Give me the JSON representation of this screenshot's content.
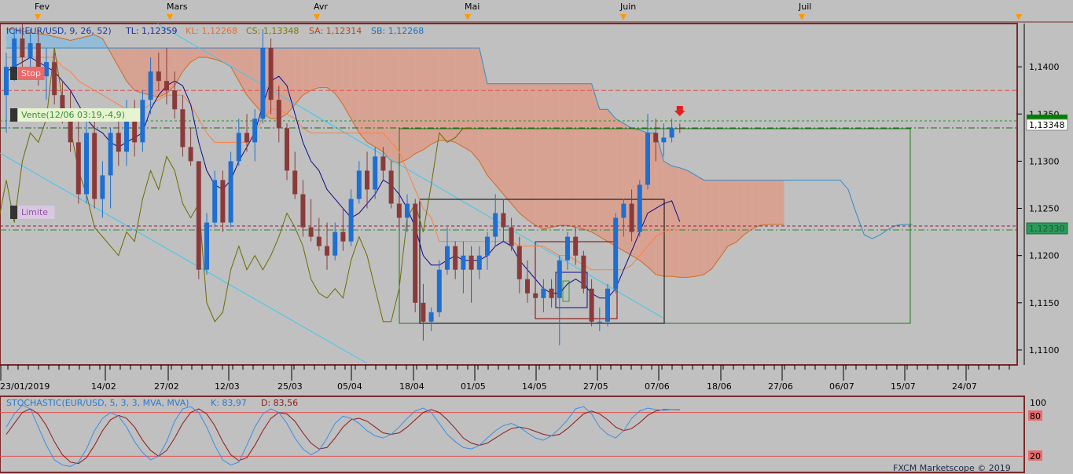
{
  "top_months": [
    "Fev",
    "Mars",
    "Avr",
    "Mai",
    "Juin",
    "Juil"
  ],
  "legend": {
    "indicator": "ICH(EUR/USD, 9, 26, 52)",
    "tl": "TL: 1,12359",
    "kl": "KL: 1,12268",
    "cs": "CS: 1,13348",
    "sa": "SA: 1,12314",
    "sb": "SB: 1,12268"
  },
  "order_labels": {
    "stop": "Stop",
    "vente": "Vente(12/06 03:19,-4,9)",
    "limite": "Limite"
  },
  "price_axis": {
    "ticks": [
      "1,1400",
      "1,1350",
      "1,1300",
      "1,1250",
      "1,1200",
      "1,1150",
      "1,1100"
    ],
    "current_price": "1,13348",
    "current_price_label_color": "#008000",
    "limit_price": "1,12330"
  },
  "date_axis": [
    "23/01/2019",
    "14/02",
    "27/02",
    "12/03",
    "25/03",
    "05/04",
    "18/04",
    "01/05",
    "14/05",
    "27/05",
    "07/06",
    "18/06",
    "27/06",
    "06/07",
    "15/07",
    "24/07"
  ],
  "stoch": {
    "label": "STOCHASTIC(EUR/USD, 5, 3, 3, MVA, MVA)",
    "k": "K: 83,97",
    "d": "D: 83,56",
    "levels": [
      "100",
      "80",
      "20"
    ]
  },
  "brand": "FXCM Marketscope © 2019",
  "colors": {
    "bull": "#1e6fd0",
    "bear": "#8b3a3a",
    "tenkan": "#0a0a8c",
    "kijun": "#ff7f3f",
    "chikou": "#6b6b00",
    "senkou_a": "#d2691e",
    "senkou_b": "#2d8cc8",
    "cloud_bear": "#d9a090",
    "cloud_bull": "#8fbcd8",
    "stoch_k": "#3a8ee6",
    "stoch_d": "#8b1a1a"
  },
  "chart_data": {
    "type": "candlestick",
    "instrument": "EUR/USD",
    "ylim": [
      1.1085,
      1.1445
    ],
    "x_labels": [
      "23/01/2019",
      "14/02",
      "27/02",
      "12/03",
      "25/03",
      "05/04",
      "18/04",
      "01/05",
      "14/05",
      "27/05",
      "07/06",
      "18/06",
      "27/06",
      "06/07",
      "15/07",
      "24/07"
    ],
    "candles": [
      {
        "o": 1.137,
        "h": 1.1415,
        "l": 1.133,
        "c": 1.14
      },
      {
        "o": 1.14,
        "h": 1.144,
        "l": 1.1385,
        "c": 1.143
      },
      {
        "o": 1.143,
        "h": 1.1445,
        "l": 1.14,
        "c": 1.141
      },
      {
        "o": 1.141,
        "h": 1.144,
        "l": 1.1395,
        "c": 1.1425
      },
      {
        "o": 1.1425,
        "h": 1.144,
        "l": 1.138,
        "c": 1.139
      },
      {
        "o": 1.139,
        "h": 1.142,
        "l": 1.1365,
        "c": 1.1405
      },
      {
        "o": 1.1405,
        "h": 1.1415,
        "l": 1.136,
        "c": 1.137
      },
      {
        "o": 1.137,
        "h": 1.1385,
        "l": 1.134,
        "c": 1.135
      },
      {
        "o": 1.135,
        "h": 1.1375,
        "l": 1.131,
        "c": 1.132
      },
      {
        "o": 1.132,
        "h": 1.1345,
        "l": 1.1255,
        "c": 1.1265
      },
      {
        "o": 1.1265,
        "h": 1.1345,
        "l": 1.1255,
        "c": 1.133
      },
      {
        "o": 1.133,
        "h": 1.1345,
        "l": 1.125,
        "c": 1.126
      },
      {
        "o": 1.126,
        "h": 1.13,
        "l": 1.124,
        "c": 1.1285
      },
      {
        "o": 1.1285,
        "h": 1.1335,
        "l": 1.125,
        "c": 1.133
      },
      {
        "o": 1.133,
        "h": 1.1345,
        "l": 1.1295,
        "c": 1.131
      },
      {
        "o": 1.131,
        "h": 1.1365,
        "l": 1.1295,
        "c": 1.1345
      },
      {
        "o": 1.1345,
        "h": 1.1365,
        "l": 1.1305,
        "c": 1.132
      },
      {
        "o": 1.132,
        "h": 1.1375,
        "l": 1.131,
        "c": 1.1365
      },
      {
        "o": 1.1365,
        "h": 1.141,
        "l": 1.135,
        "c": 1.1395
      },
      {
        "o": 1.1395,
        "h": 1.1415,
        "l": 1.1375,
        "c": 1.1385
      },
      {
        "o": 1.1385,
        "h": 1.142,
        "l": 1.136,
        "c": 1.1375
      },
      {
        "o": 1.1375,
        "h": 1.1395,
        "l": 1.1345,
        "c": 1.1355
      },
      {
        "o": 1.1355,
        "h": 1.137,
        "l": 1.1305,
        "c": 1.1315
      },
      {
        "o": 1.1315,
        "h": 1.1335,
        "l": 1.1295,
        "c": 1.13
      },
      {
        "o": 1.13,
        "h": 1.13,
        "l": 1.1175,
        "c": 1.1185
      },
      {
        "o": 1.1185,
        "h": 1.1245,
        "l": 1.118,
        "c": 1.1235
      },
      {
        "o": 1.1235,
        "h": 1.129,
        "l": 1.123,
        "c": 1.128
      },
      {
        "o": 1.128,
        "h": 1.129,
        "l": 1.1225,
        "c": 1.1235
      },
      {
        "o": 1.1235,
        "h": 1.131,
        "l": 1.123,
        "c": 1.13
      },
      {
        "o": 1.13,
        "h": 1.1345,
        "l": 1.1295,
        "c": 1.133
      },
      {
        "o": 1.133,
        "h": 1.135,
        "l": 1.131,
        "c": 1.132
      },
      {
        "o": 1.132,
        "h": 1.1355,
        "l": 1.13,
        "c": 1.1345
      },
      {
        "o": 1.1345,
        "h": 1.144,
        "l": 1.134,
        "c": 1.142
      },
      {
        "o": 1.142,
        "h": 1.143,
        "l": 1.135,
        "c": 1.1365
      },
      {
        "o": 1.1365,
        "h": 1.138,
        "l": 1.132,
        "c": 1.1335
      },
      {
        "o": 1.1335,
        "h": 1.134,
        "l": 1.128,
        "c": 1.129
      },
      {
        "o": 1.129,
        "h": 1.131,
        "l": 1.126,
        "c": 1.1265
      },
      {
        "o": 1.1265,
        "h": 1.128,
        "l": 1.122,
        "c": 1.123
      },
      {
        "o": 1.123,
        "h": 1.126,
        "l": 1.1215,
        "c": 1.122
      },
      {
        "o": 1.122,
        "h": 1.124,
        "l": 1.1205,
        "c": 1.121
      },
      {
        "o": 1.121,
        "h": 1.1235,
        "l": 1.1185,
        "c": 1.12
      },
      {
        "o": 1.12,
        "h": 1.1235,
        "l": 1.1195,
        "c": 1.1225
      },
      {
        "o": 1.1225,
        "h": 1.125,
        "l": 1.1205,
        "c": 1.1215
      },
      {
        "o": 1.1215,
        "h": 1.127,
        "l": 1.121,
        "c": 1.126
      },
      {
        "o": 1.126,
        "h": 1.13,
        "l": 1.1255,
        "c": 1.129
      },
      {
        "o": 1.129,
        "h": 1.131,
        "l": 1.125,
        "c": 1.127
      },
      {
        "o": 1.127,
        "h": 1.1315,
        "l": 1.126,
        "c": 1.1305
      },
      {
        "o": 1.1305,
        "h": 1.1315,
        "l": 1.128,
        "c": 1.129
      },
      {
        "o": 1.129,
        "h": 1.13,
        "l": 1.125,
        "c": 1.1255
      },
      {
        "o": 1.1255,
        "h": 1.1265,
        "l": 1.123,
        "c": 1.124
      },
      {
        "o": 1.124,
        "h": 1.1265,
        "l": 1.1225,
        "c": 1.1255
      },
      {
        "o": 1.1255,
        "h": 1.126,
        "l": 1.114,
        "c": 1.115
      },
      {
        "o": 1.115,
        "h": 1.117,
        "l": 1.111,
        "c": 1.113
      },
      {
        "o": 1.113,
        "h": 1.1145,
        "l": 1.112,
        "c": 1.114
      },
      {
        "o": 1.114,
        "h": 1.1195,
        "l": 1.1135,
        "c": 1.1185
      },
      {
        "o": 1.1185,
        "h": 1.123,
        "l": 1.118,
        "c": 1.121
      },
      {
        "o": 1.121,
        "h": 1.1215,
        "l": 1.1175,
        "c": 1.1185
      },
      {
        "o": 1.1185,
        "h": 1.1215,
        "l": 1.116,
        "c": 1.12
      },
      {
        "o": 1.12,
        "h": 1.121,
        "l": 1.115,
        "c": 1.1185
      },
      {
        "o": 1.1185,
        "h": 1.121,
        "l": 1.1175,
        "c": 1.12
      },
      {
        "o": 1.12,
        "h": 1.1225,
        "l": 1.1185,
        "c": 1.122
      },
      {
        "o": 1.122,
        "h": 1.1265,
        "l": 1.121,
        "c": 1.1245
      },
      {
        "o": 1.1245,
        "h": 1.126,
        "l": 1.1215,
        "c": 1.123
      },
      {
        "o": 1.123,
        "h": 1.124,
        "l": 1.1205,
        "c": 1.121
      },
      {
        "o": 1.121,
        "h": 1.122,
        "l": 1.116,
        "c": 1.1175
      },
      {
        "o": 1.1175,
        "h": 1.1195,
        "l": 1.115,
        "c": 1.116
      },
      {
        "o": 1.116,
        "h": 1.118,
        "l": 1.1145,
        "c": 1.1155
      },
      {
        "o": 1.1155,
        "h": 1.1175,
        "l": 1.114,
        "c": 1.1165
      },
      {
        "o": 1.1165,
        "h": 1.1175,
        "l": 1.1145,
        "c": 1.1155
      },
      {
        "o": 1.1155,
        "h": 1.12,
        "l": 1.1105,
        "c": 1.1195
      },
      {
        "o": 1.1195,
        "h": 1.1225,
        "l": 1.1185,
        "c": 1.122
      },
      {
        "o": 1.122,
        "h": 1.123,
        "l": 1.119,
        "c": 1.12
      },
      {
        "o": 1.12,
        "h": 1.1205,
        "l": 1.116,
        "c": 1.1165
      },
      {
        "o": 1.1165,
        "h": 1.1175,
        "l": 1.1125,
        "c": 1.113
      },
      {
        "o": 1.113,
        "h": 1.1145,
        "l": 1.112,
        "c": 1.113
      },
      {
        "o": 1.113,
        "h": 1.117,
        "l": 1.1125,
        "c": 1.1165
      },
      {
        "o": 1.1165,
        "h": 1.1245,
        "l": 1.116,
        "c": 1.124
      },
      {
        "o": 1.124,
        "h": 1.126,
        "l": 1.122,
        "c": 1.1255
      },
      {
        "o": 1.1255,
        "h": 1.127,
        "l": 1.1215,
        "c": 1.1225
      },
      {
        "o": 1.1225,
        "h": 1.128,
        "l": 1.122,
        "c": 1.1275
      },
      {
        "o": 1.1275,
        "h": 1.135,
        "l": 1.127,
        "c": 1.133
      },
      {
        "o": 1.133,
        "h": 1.1345,
        "l": 1.13,
        "c": 1.132
      },
      {
        "o": 1.132,
        "h": 1.134,
        "l": 1.1305,
        "c": 1.1325
      },
      {
        "o": 1.1325,
        "h": 1.1345,
        "l": 1.132,
        "c": 1.1335
      },
      {
        "o": 1.1335,
        "h": 1.134,
        "l": 1.133,
        "c": 1.13348
      }
    ],
    "tenkan": [
      1.1395,
      1.14,
      1.1405,
      1.141,
      1.1405,
      1.14,
      1.1395,
      1.1385,
      1.1375,
      1.136,
      1.1345,
      1.1335,
      1.133,
      1.132,
      1.1315,
      1.132,
      1.1325,
      1.133,
      1.1355,
      1.137,
      1.138,
      1.1385,
      1.138,
      1.136,
      1.132,
      1.129,
      1.1275,
      1.127,
      1.128,
      1.13,
      1.1315,
      1.133,
      1.136,
      1.1385,
      1.139,
      1.138,
      1.135,
      1.132,
      1.13,
      1.129,
      1.127,
      1.126,
      1.125,
      1.124,
      1.1245,
      1.1255,
      1.1265,
      1.128,
      1.1275,
      1.1265,
      1.125,
      1.123,
      1.12,
      1.119,
      1.119,
      1.1195,
      1.12,
      1.1195,
      1.1195,
      1.1195,
      1.12,
      1.121,
      1.1215,
      1.121,
      1.1195,
      1.1185,
      1.1175,
      1.1165,
      1.116,
      1.116,
      1.117,
      1.1175,
      1.117,
      1.116,
      1.1155,
      1.1155,
      1.1165,
      1.1185,
      1.1205,
      1.1225,
      1.1245,
      1.125,
      1.1255,
      1.1258,
      1.12359
    ],
    "kijun": [
      1.141,
      1.141,
      1.141,
      1.141,
      1.141,
      1.141,
      1.141,
      1.14,
      1.1395,
      1.1385,
      1.138,
      1.1375,
      1.137,
      1.1365,
      1.136,
      1.1355,
      1.1355,
      1.1355,
      1.136,
      1.1365,
      1.137,
      1.137,
      1.137,
      1.136,
      1.1345,
      1.133,
      1.132,
      1.132,
      1.132,
      1.132,
      1.132,
      1.133,
      1.1345,
      1.1355,
      1.1355,
      1.135,
      1.1345,
      1.1335,
      1.133,
      1.133,
      1.133,
      1.133,
      1.133,
      1.133,
      1.133,
      1.133,
      1.133,
      1.133,
      1.132,
      1.131,
      1.129,
      1.127,
      1.125,
      1.124,
      1.1215,
      1.1215,
      1.1215,
      1.1215,
      1.1215,
      1.1215,
      1.1215,
      1.1215,
      1.1215,
      1.1215,
      1.121,
      1.121,
      1.121,
      1.121,
      1.1205,
      1.12,
      1.12,
      1.1195,
      1.119,
      1.1185,
      1.1185,
      1.1185,
      1.1185,
      1.1185,
      1.119,
      1.12,
      1.121,
      1.122,
      1.1225,
      1.1228,
      1.12268
    ],
    "chikou_offset": -26,
    "cloud_start_index": 0,
    "senkou_a": [
      1.144,
      1.144,
      1.1438,
      1.1436,
      1.1435,
      1.1434,
      1.1432,
      1.143,
      1.1428,
      1.143,
      1.1432,
      1.1434,
      1.143,
      1.1415,
      1.14,
      1.1385,
      1.1375,
      1.1372,
      1.137,
      1.1368,
      1.1372,
      1.138,
      1.1395,
      1.1405,
      1.141,
      1.141,
      1.1408,
      1.1405,
      1.14,
      1.1385,
      1.137,
      1.136,
      1.135,
      1.1345,
      1.1345,
      1.135,
      1.136,
      1.137,
      1.1375,
      1.1378,
      1.1378,
      1.1372,
      1.136,
      1.1345,
      1.133,
      1.132,
      1.1315,
      1.131,
      1.13,
      1.1298,
      1.1302,
      1.1308,
      1.1312,
      1.1318,
      1.1322,
      1.1322,
      1.132,
      1.1315,
      1.131,
      1.13,
      1.1285,
      1.1275,
      1.1265,
      1.1255,
      1.1245,
      1.1238,
      1.1232,
      1.1228,
      1.123,
      1.1232,
      1.1232,
      1.123,
      1.1228,
      1.1225,
      1.122,
      1.1215,
      1.121,
      1.1205,
      1.12,
      1.1195,
      1.1188,
      1.118,
      1.1178,
      1.1178,
      1.1177,
      1.1177,
      1.1178,
      1.118,
      1.1186,
      1.1198,
      1.121,
      1.1214,
      1.1222,
      1.1228,
      1.1232,
      1.1233,
      1.1233,
      1.1233
    ],
    "senkou_b": [
      1.142,
      1.142,
      1.142,
      1.142,
      1.142,
      1.142,
      1.142,
      1.142,
      1.142,
      1.142,
      1.142,
      1.142,
      1.142,
      1.142,
      1.142,
      1.142,
      1.142,
      1.142,
      1.142,
      1.142,
      1.142,
      1.142,
      1.142,
      1.142,
      1.142,
      1.142,
      1.142,
      1.142,
      1.142,
      1.142,
      1.142,
      1.142,
      1.142,
      1.142,
      1.142,
      1.142,
      1.142,
      1.142,
      1.142,
      1.142,
      1.142,
      1.142,
      1.142,
      1.142,
      1.142,
      1.142,
      1.142,
      1.142,
      1.142,
      1.142,
      1.142,
      1.142,
      1.142,
      1.142,
      1.142,
      1.142,
      1.142,
      1.142,
      1.142,
      1.142,
      1.1382,
      1.1382,
      1.1382,
      1.1382,
      1.1382,
      1.1382,
      1.1382,
      1.1382,
      1.1382,
      1.1382,
      1.1382,
      1.1382,
      1.1382,
      1.1382,
      1.1355,
      1.1355,
      1.1345,
      1.134,
      1.1335,
      1.1333,
      1.133,
      1.133,
      1.13,
      1.1295,
      1.1293,
      1.129,
      1.1285,
      1.128,
      1.128,
      1.128,
      1.128,
      1.128,
      1.128,
      1.128,
      1.128,
      1.128,
      1.128,
      1.128,
      1.128,
      1.128,
      1.128,
      1.128,
      1.128,
      1.128,
      1.128,
      1.127,
      1.1245,
      1.1222,
      1.1218,
      1.1222,
      1.1228,
      1.1232,
      1.1233,
      1.1233
    ],
    "stop_level": 1.1375,
    "entry_level": 1.13348,
    "limit_level": 1.1233,
    "stoch_k": [
      60,
      78,
      90,
      85,
      60,
      35,
      15,
      8,
      6,
      12,
      30,
      55,
      72,
      80,
      75,
      60,
      40,
      25,
      15,
      20,
      40,
      68,
      85,
      88,
      80,
      60,
      35,
      15,
      8,
      12,
      35,
      60,
      78,
      85,
      80,
      65,
      45,
      30,
      22,
      28,
      45,
      65,
      75,
      72,
      65,
      55,
      48,
      45,
      50,
      60,
      72,
      82,
      86,
      80,
      65,
      50,
      40,
      32,
      30,
      35,
      45,
      55,
      62,
      65,
      60,
      52,
      45,
      42,
      48,
      58,
      70,
      85,
      88,
      78,
      60,
      50,
      45,
      55,
      72,
      82,
      86,
      84,
      83,
      84,
      83.97
    ],
    "stoch_d": [
      50,
      65,
      80,
      85,
      78,
      62,
      40,
      22,
      12,
      10,
      18,
      35,
      55,
      70,
      76,
      72,
      60,
      42,
      28,
      20,
      28,
      45,
      65,
      80,
      85,
      78,
      62,
      40,
      22,
      14,
      18,
      35,
      55,
      72,
      80,
      78,
      68,
      52,
      38,
      30,
      32,
      45,
      60,
      70,
      72,
      68,
      60,
      52,
      50,
      52,
      60,
      70,
      80,
      84,
      80,
      70,
      58,
      45,
      38,
      35,
      38,
      45,
      52,
      58,
      60,
      58,
      54,
      50,
      48,
      50,
      58,
      68,
      78,
      82,
      78,
      70,
      60,
      55,
      58,
      66,
      76,
      82,
      84,
      84,
      83.56
    ]
  }
}
